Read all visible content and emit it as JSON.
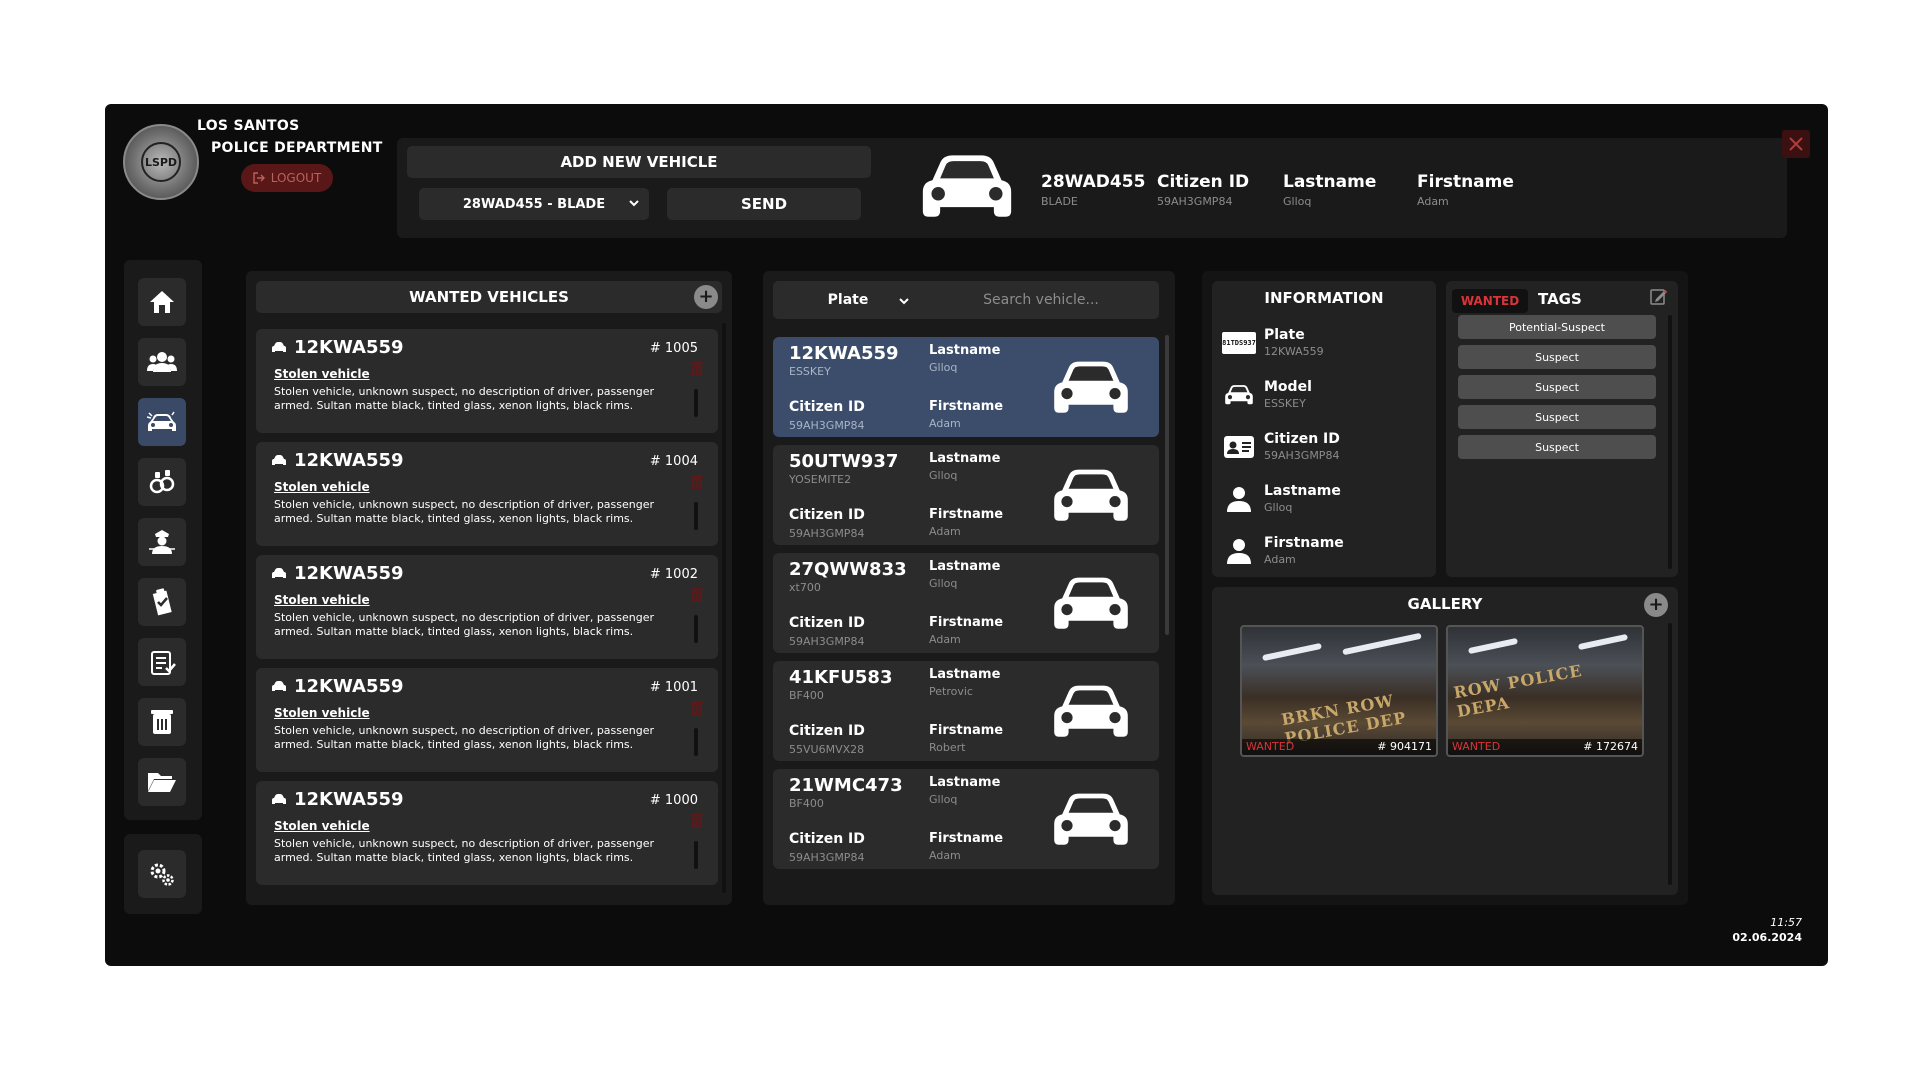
{
  "header": {
    "dept_line1": "LOS SANTOS",
    "dept_line2": "POLICE DEPARTMENT",
    "logo_text": "LSPD",
    "logout": "LOGOUT",
    "add_title": "ADD NEW VEHICLE",
    "vehicle_select": "28WAD455 - BLADE",
    "send": "SEND",
    "selected": {
      "plate": "28WAD455",
      "model": "BLADE",
      "citizen_id_label": "Citizen ID",
      "citizen_id": "59AH3GMP84",
      "lastname_label": "Lastname",
      "lastname": "Glloq",
      "firstname_label": "Firstname",
      "firstname": "Adam"
    }
  },
  "wanted": {
    "title": "WANTED VEHICLES",
    "items": [
      {
        "plate": "12KWA559",
        "num": "# 1005",
        "title": "Stolen vehicle",
        "desc": "Stolen vehicle, unknown suspect, no description of driver, passenger armed. Sultan matte black, tinted glass, xenon lights, black rims."
      },
      {
        "plate": "12KWA559",
        "num": "# 1004",
        "title": "Stolen vehicle",
        "desc": "Stolen vehicle, unknown suspect, no description of driver, passenger armed. Sultan matte black, tinted glass, xenon lights, black rims."
      },
      {
        "plate": "12KWA559",
        "num": "# 1002",
        "title": "Stolen vehicle",
        "desc": "Stolen vehicle, unknown suspect, no description of driver, passenger armed. Sultan matte black, tinted glass, xenon lights, black rims."
      },
      {
        "plate": "12KWA559",
        "num": "# 1001",
        "title": "Stolen vehicle",
        "desc": "Stolen vehicle, unknown suspect, no description of driver, passenger armed. Sultan matte black, tinted glass, xenon lights, black rims."
      },
      {
        "plate": "12KWA559",
        "num": "# 1000",
        "title": "Stolen vehicle",
        "desc": "Stolen vehicle, unknown suspect, no description of driver, passenger armed. Sultan matte black, tinted glass, xenon lights, black rims."
      }
    ]
  },
  "search": {
    "filter": "Plate",
    "placeholder": "Search vehicle...",
    "labels": {
      "citizen_id": "Citizen ID",
      "lastname": "Lastname",
      "firstname": "Firstname"
    },
    "results": [
      {
        "plate": "12KWA559",
        "model": "ESSKEY",
        "citizen_id": "59AH3GMP84",
        "lastname": "Glloq",
        "firstname": "Adam"
      },
      {
        "plate": "50UTW937",
        "model": "YOSEMITE2",
        "citizen_id": "59AH3GMP84",
        "lastname": "Glloq",
        "firstname": "Adam"
      },
      {
        "plate": "27QWW833",
        "model": "xt700",
        "citizen_id": "59AH3GMP84",
        "lastname": "Glloq",
        "firstname": "Adam"
      },
      {
        "plate": "41KFU583",
        "model": "BF400",
        "citizen_id": "55VU6MVX28",
        "lastname": "Petrovic",
        "firstname": "Robert"
      },
      {
        "plate": "21WMC473",
        "model": "BF400",
        "citizen_id": "59AH3GMP84",
        "lastname": "Glloq",
        "firstname": "Adam"
      }
    ]
  },
  "information": {
    "title": "INFORMATION",
    "plate_badge": "81TDS937",
    "rows": [
      {
        "label": "Plate",
        "value": "12KWA559"
      },
      {
        "label": "Model",
        "value": "ESSKEY"
      },
      {
        "label": "Citizen ID",
        "value": "59AH3GMP84"
      },
      {
        "label": "Lastname",
        "value": "Glloq"
      },
      {
        "label": "Firstname",
        "value": "Adam"
      }
    ]
  },
  "tags": {
    "wanted": "WANTED",
    "title": "TAGS",
    "items": [
      "Potential-Suspect",
      "Suspect",
      "Suspect",
      "Suspect",
      "Suspect"
    ]
  },
  "gallery": {
    "title": "GALLERY",
    "images": [
      {
        "tag": "WANTED",
        "id": "# 904171",
        "sign": "BRKN ROW POLICE DEP"
      },
      {
        "tag": "WANTED",
        "id": "# 172674",
        "sign": "ROW POLICE DEPA"
      }
    ]
  },
  "clock": {
    "time": "11:57",
    "date": "02.06.2024"
  },
  "colors": {
    "accent_selected": "#3b4d6b",
    "danger": "#d9343a",
    "panel": "#1a1a1a"
  }
}
